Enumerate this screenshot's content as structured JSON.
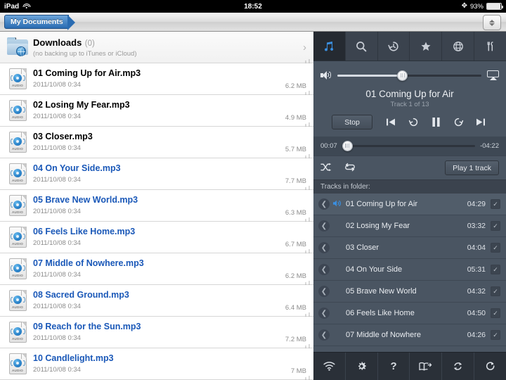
{
  "status_bar": {
    "device": "iPad",
    "wifi_icon": "wifi-icon",
    "time": "18:52",
    "bluetooth_icon": "bluetooth-icon",
    "battery_percent": "93%",
    "battery_level": 93
  },
  "navbar": {
    "breadcrumb": "My Documents",
    "stepper_icon": "up-down-stepper-icon"
  },
  "file_list": {
    "folder": {
      "name": "Downloads",
      "count": "(0)",
      "subtitle": "(no backing up to iTunes or iCloud)",
      "chevron": "›",
      "icon": "folder-globe-icon"
    },
    "files": [
      {
        "name": "01 Coming Up for Air.mp3",
        "date": "2011/10/08 0:34",
        "size": "6.2 MB",
        "link": false
      },
      {
        "name": "02 Losing My Fear.mp3",
        "date": "2011/10/08 0:34",
        "size": "4.9 MB",
        "link": false
      },
      {
        "name": "03 Closer.mp3",
        "date": "2011/10/08 0:34",
        "size": "5.7 MB",
        "link": false
      },
      {
        "name": "04 On Your Side.mp3",
        "date": "2011/10/08 0:34",
        "size": "7.7 MB",
        "link": true
      },
      {
        "name": "05 Brave New World.mp3",
        "date": "2011/10/08 0:34",
        "size": "6.3 MB",
        "link": true
      },
      {
        "name": "06 Feels Like Home.mp3",
        "date": "2011/10/08 0:34",
        "size": "6.7 MB",
        "link": true
      },
      {
        "name": "07 Middle of Nowhere.mp3",
        "date": "2011/10/08 0:34",
        "size": "6.2 MB",
        "link": true
      },
      {
        "name": "08 Sacred Ground.mp3",
        "date": "2011/10/08 0:34",
        "size": "6.4 MB",
        "link": true
      },
      {
        "name": "09 Reach for the Sun.mp3",
        "date": "2011/10/08 0:34",
        "size": "7.2 MB",
        "link": true
      },
      {
        "name": "10 Candlelight.mp3",
        "date": "2011/10/08 0:34",
        "size": "7 MB",
        "link": true
      }
    ]
  },
  "right_panel": {
    "tabs": [
      {
        "icon": "music-note-icon",
        "active": true
      },
      {
        "icon": "search-icon",
        "active": false
      },
      {
        "icon": "history-icon",
        "active": false
      },
      {
        "icon": "star-icon",
        "active": false
      },
      {
        "icon": "globe-icon",
        "active": false
      },
      {
        "icon": "tools-icon",
        "active": false
      }
    ],
    "player": {
      "volume_icon": "speaker-icon",
      "volume_percent": 45,
      "airplay_icon": "airplay-icon",
      "now_playing_title": "01 Coming Up for Air",
      "track_position": "Track 1 of 13",
      "stop_label": "Stop",
      "controls": [
        {
          "icon": "previous-track-icon"
        },
        {
          "icon": "rewind-15-icon"
        },
        {
          "icon": "pause-icon"
        },
        {
          "icon": "forward-15-icon"
        },
        {
          "icon": "next-track-icon"
        }
      ],
      "elapsed": "00:07",
      "remaining": "-04:22",
      "progress_percent": 3
    },
    "options": {
      "shuffle_icon": "shuffle-icon",
      "repeat_icon": "repeat-icon",
      "play_button_label": "Play 1 track"
    },
    "tracks_header": "Tracks in folder:",
    "tracks": [
      {
        "name": "01 Coming Up for Air",
        "duration": "04:29",
        "current": true,
        "checked": true
      },
      {
        "name": "02 Losing My Fear",
        "duration": "03:32",
        "current": false,
        "checked": true
      },
      {
        "name": "03 Closer",
        "duration": "04:04",
        "current": false,
        "checked": true
      },
      {
        "name": "04 On Your Side",
        "duration": "05:31",
        "current": false,
        "checked": true
      },
      {
        "name": "05 Brave New World",
        "duration": "04:32",
        "current": false,
        "checked": true
      },
      {
        "name": "06 Feels Like Home",
        "duration": "04:50",
        "current": false,
        "checked": true
      },
      {
        "name": "07 Middle of Nowhere",
        "duration": "04:26",
        "current": false,
        "checked": true
      }
    ],
    "bottom_bar": [
      {
        "icon": "wifi-icon"
      },
      {
        "icon": "gear-icon"
      },
      {
        "icon": "help-question-icon"
      },
      {
        "icon": "manual-book-icon"
      },
      {
        "icon": "sync-icon"
      },
      {
        "icon": "refresh-icon"
      }
    ]
  },
  "colors": {
    "accent_blue": "#3a8fe0",
    "link_blue": "#1a58b8",
    "panel_bg": "#4a5562",
    "tabbar_bg": "#3b434e",
    "bottom_bar_bg": "#2a3038"
  }
}
